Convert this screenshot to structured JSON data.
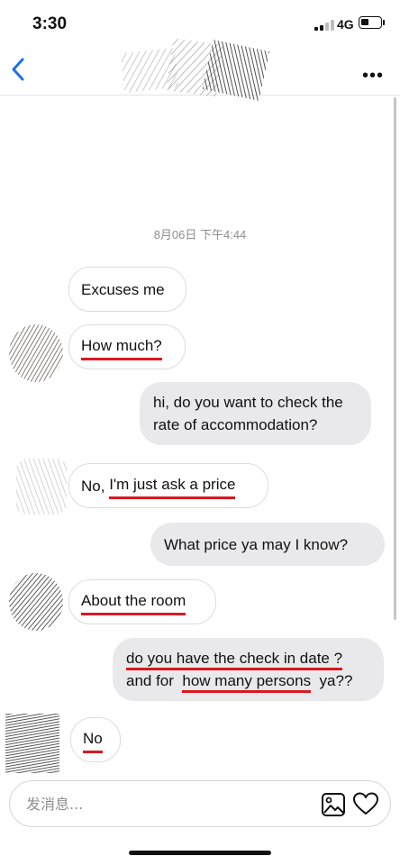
{
  "status_bar": {
    "time": "3:30",
    "network": "4G",
    "signal_bars_active": 2,
    "signal_bars_total": 4,
    "battery_level": 0.4
  },
  "header": {
    "back_icon": "chevron-left-icon",
    "more_icon": "more-dots-icon",
    "accent_color": "#1a73e8"
  },
  "conversation": {
    "timestamp": "8月06日 下午4:44",
    "messages": [
      {
        "direction": "incoming",
        "text": "Excuses me"
      },
      {
        "direction": "incoming",
        "text": "How much?"
      },
      {
        "direction": "outgoing",
        "lines": [
          "hi, do you want to check the",
          "rate of accommodation?"
        ]
      },
      {
        "direction": "incoming",
        "pre": "No, ",
        "underlined": "I'm just ask a price"
      },
      {
        "direction": "outgoing",
        "text": "What price ya may I know?"
      },
      {
        "direction": "incoming",
        "text": "About the room"
      },
      {
        "direction": "outgoing",
        "line1": "do you have the check in date ?",
        "line2_pre": "and for ",
        "line2_underlined": "how many persons",
        "line2_post": " ya??"
      },
      {
        "direction": "incoming",
        "text": "No"
      }
    ]
  },
  "composer": {
    "placeholder": "发消息...",
    "image_icon": "image-icon",
    "like_icon": "heart-icon"
  },
  "colors": {
    "incoming_bubble": "#ffffff",
    "outgoing_bubble": "#e9e9eb",
    "underline": "#d81820",
    "muted_text": "#8e8e8e"
  }
}
